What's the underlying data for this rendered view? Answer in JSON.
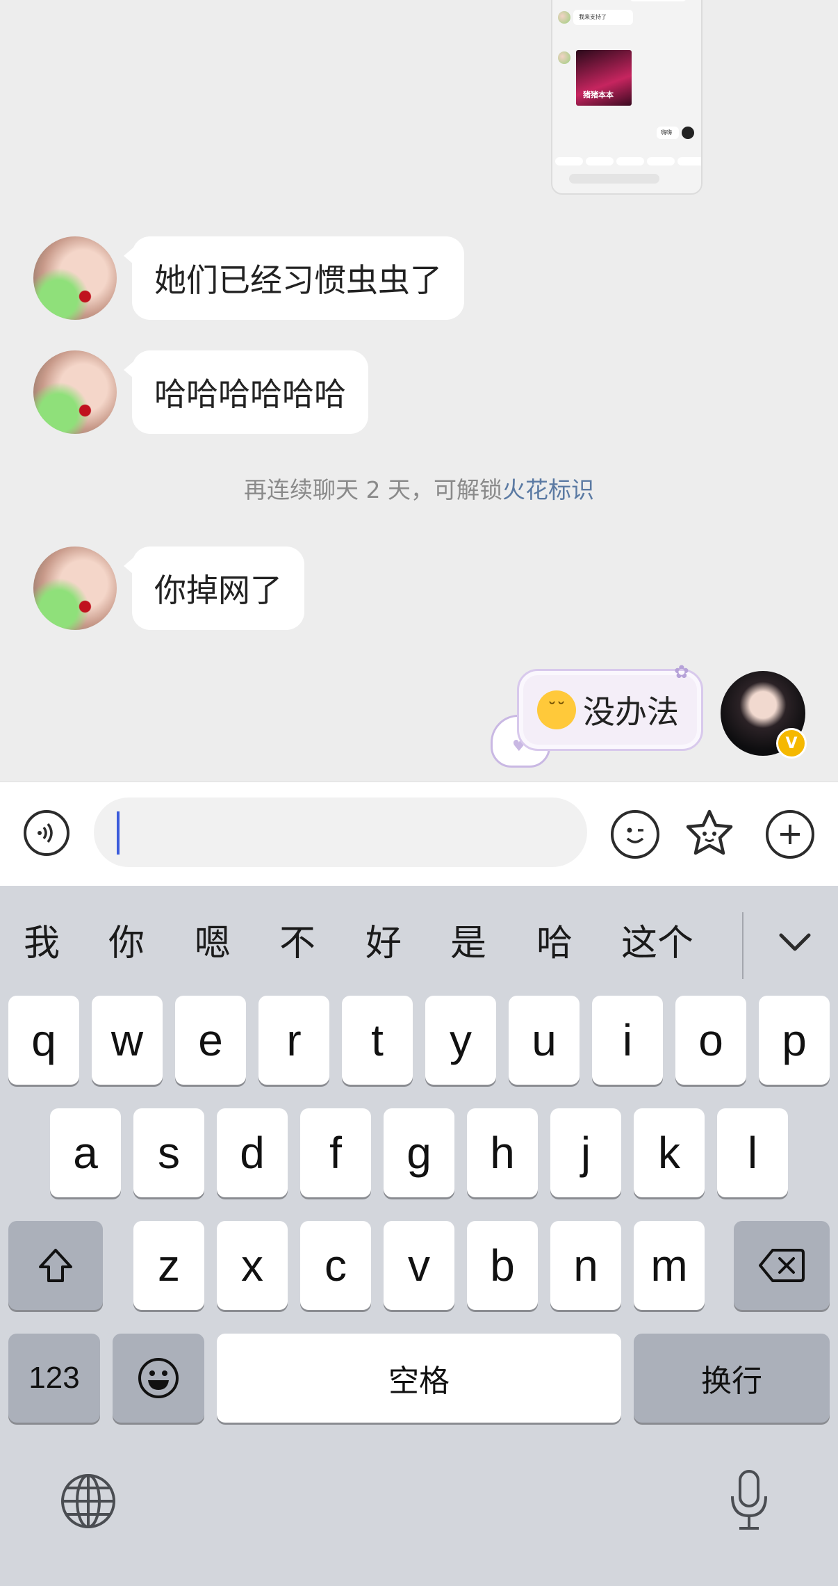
{
  "chat": {
    "shared_screenshot": {
      "line1": "我来支持了",
      "image_caption": "猪猪本本",
      "reply": "嗨嗨"
    },
    "messages": [
      {
        "from": "them",
        "text": "她们已经习惯虫虫了"
      },
      {
        "from": "them",
        "text": "哈哈哈哈哈哈"
      },
      {
        "from": "them",
        "text": "你掉网了"
      }
    ],
    "system_note": {
      "prefix": "再连续聊天 2 天，可解锁",
      "link": "火花标识"
    },
    "my_message": {
      "emoji": "sleepy-face-emoji",
      "text": "没办法"
    },
    "my_avatar_badge": "V"
  },
  "input_bar": {
    "voice_icon": "voice-icon",
    "text_value": "",
    "emoji_icon": "smile-icon",
    "sticker_icon": "sticker-star-icon",
    "more_icon": "plus-icon"
  },
  "keyboard": {
    "candidates": [
      "我",
      "你",
      "嗯",
      "不",
      "好",
      "是",
      "哈",
      "这个"
    ],
    "rows": [
      [
        "q",
        "w",
        "e",
        "r",
        "t",
        "y",
        "u",
        "i",
        "o",
        "p"
      ],
      [
        "a",
        "s",
        "d",
        "f",
        "g",
        "h",
        "j",
        "k",
        "l"
      ],
      [
        "z",
        "x",
        "c",
        "v",
        "b",
        "n",
        "m"
      ]
    ],
    "numbers_key": "123",
    "space_key": "空格",
    "return_key": "换行"
  },
  "colors": {
    "chat_background": "#ededed",
    "keyboard_background": "#d3d6dc",
    "link_blue": "#5b7aa3",
    "caret_blue": "#3b5bdb"
  }
}
